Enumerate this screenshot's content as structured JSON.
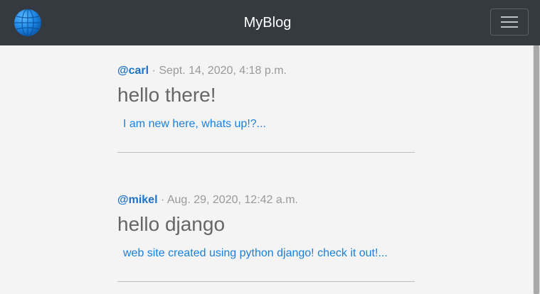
{
  "navbar": {
    "title": "MyBlog",
    "logo_icon": "globe-icon",
    "menu_icon": "hamburger-menu-icon"
  },
  "posts": [
    {
      "author": "@carl",
      "separator": "·",
      "date": "Sept. 14, 2020, 4:18 p.m.",
      "title": "hello there!",
      "excerpt": "I am new here, whats up!?..."
    },
    {
      "author": "@mikel",
      "separator": "·",
      "date": "Aug. 29, 2020, 12:42 a.m.",
      "title": "hello django",
      "excerpt": "web site created using python django! check it out!..."
    }
  ],
  "colors": {
    "navbar_bg": "#343a40",
    "page_bg": "#f4f4f4",
    "author_link": "#1a73c8",
    "excerpt_link": "#1a80e0",
    "title_text": "#666666",
    "meta_text": "#999999"
  }
}
